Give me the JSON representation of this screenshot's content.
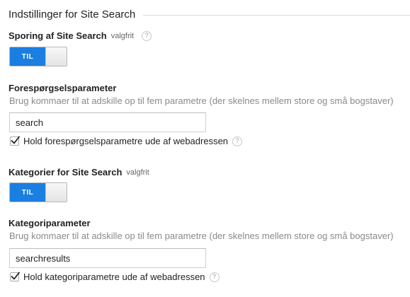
{
  "section": {
    "title": "Indstillinger for Site Search"
  },
  "site_search_tracking": {
    "label": "Sporing af Site Search",
    "optional": "valgfrit",
    "help_icon": "?",
    "toggle_label": "TIL",
    "toggle_state": "on"
  },
  "query_parameter": {
    "label": "Forespørgselsparameter",
    "helper": "Brug kommaer til at adskille op til fem parametre (der skelnes mellem store og små bogstaver)",
    "value": "search",
    "checkbox_label": "Hold forespørgselsparametre ude af webadressen",
    "checkbox_checked": true,
    "help_icon": "?"
  },
  "site_search_categories": {
    "label": "Kategorier for Site Search",
    "optional": "valgfrit",
    "toggle_label": "TIL",
    "toggle_state": "on"
  },
  "category_parameter": {
    "label": "Kategoriparameter",
    "helper": "Brug kommaer til at adskille op til fem parametre (der skelnes mellem store og små bogstaver)",
    "value": "searchresults",
    "checkbox_label": "Hold kategoriparametre ude af webadressen",
    "checkbox_checked": true,
    "help_icon": "?"
  },
  "colors": {
    "toggle_on": "#1a7fe0",
    "helper_text": "#8a8a8a",
    "rule": "#dddddd"
  },
  "icons": {
    "help": "help-icon",
    "check": "checkmark-icon"
  }
}
